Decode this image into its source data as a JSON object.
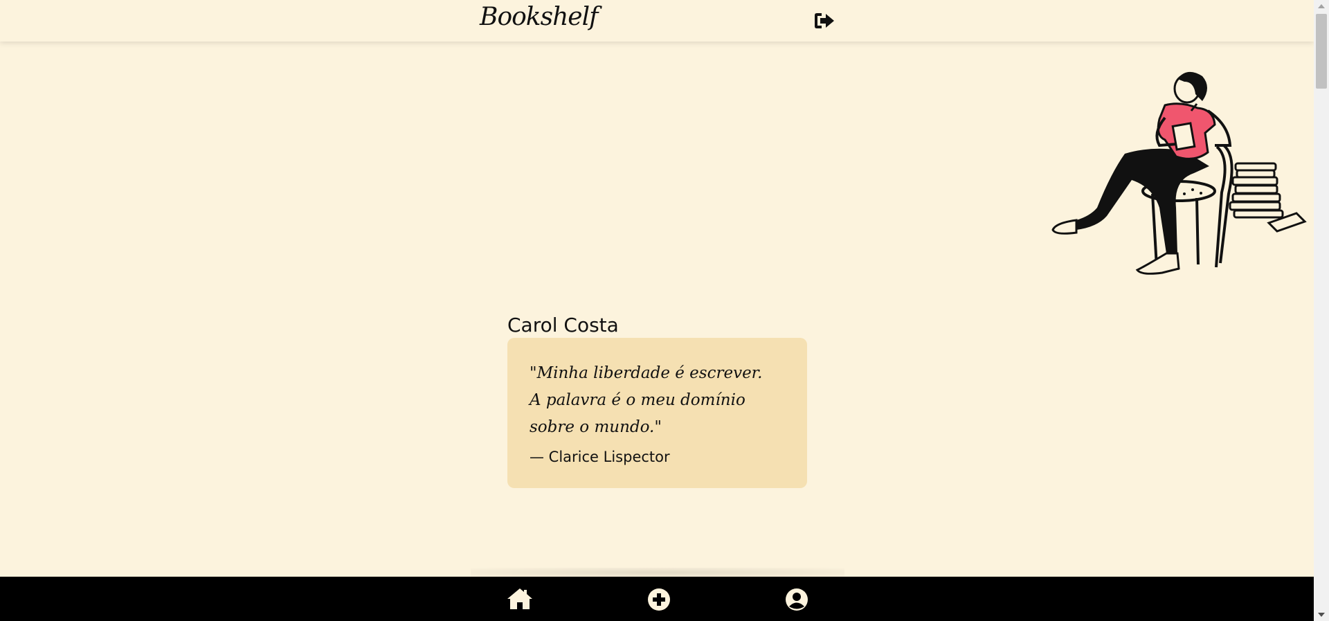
{
  "header": {
    "brand": "Bookshelf",
    "logout_icon": "sign-out-icon"
  },
  "profile": {
    "name": "Carol Costa",
    "quote": "\"Minha liberdade é escrever.\nA palavra é o meu domínio sobre o mundo.\"",
    "author": "— Clarice Lispector"
  },
  "illustration": {
    "icon": "person-reading-in-chair-illustration"
  },
  "bottom_nav": {
    "items": [
      {
        "icon": "home-icon"
      },
      {
        "icon": "plus-circle-icon"
      },
      {
        "icon": "user-circle-icon"
      }
    ]
  },
  "colors": {
    "background": "#fcf3dd",
    "card": "#f5e0b2",
    "nav": "#000000",
    "accent": "#f0566e"
  }
}
